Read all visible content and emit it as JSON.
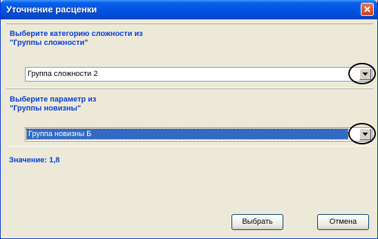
{
  "window": {
    "title": "Уточнение расценки",
    "close_icon": "close-icon"
  },
  "complexity": {
    "label": "Выберите категорию сложности из\n\"Группы сложности\"",
    "selected": "Группа сложности 2"
  },
  "novelty": {
    "label": "Выберите параметр из\n\"Группы новизны\"",
    "selected": "Группа новизны Б"
  },
  "value_text": "Значение: 1,8",
  "buttons": {
    "select": "Выбрать",
    "cancel": "Отмена"
  },
  "colors": {
    "title_bar": "#0055E5",
    "label_text": "#0A3FD6",
    "selection": "#316AC5",
    "background": "#ECE9D8"
  }
}
